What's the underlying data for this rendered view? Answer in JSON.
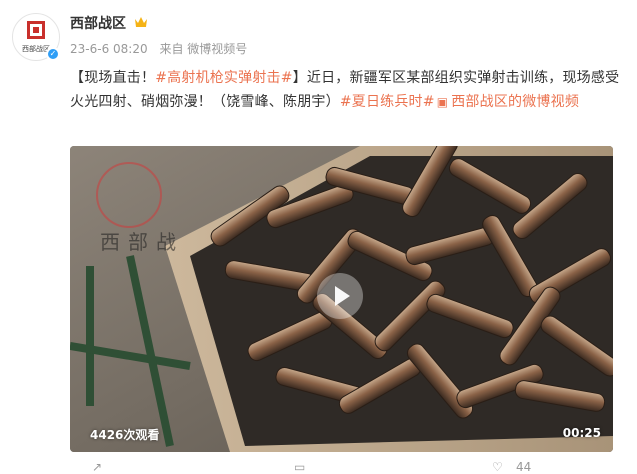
{
  "account": {
    "name": "西部战区",
    "avatar_label": "西部战区",
    "avatar_glyph": "西"
  },
  "meta": {
    "date": "23-6-6 08:20",
    "source": "来自 微博视频号"
  },
  "post": {
    "prefix": "【现场直击！",
    "tag1": "#高射机枪实弹射击#",
    "text1": "】近日，新疆军区某部组织实弹射击训练，现场感受火光四射、硝烟弥漫！（饶雪峰、陈朋宇）",
    "tag2": "#夏日练兵时#",
    "link": "西部战区的微博视频"
  },
  "video": {
    "views": "4426次观看",
    "duration": "00:25",
    "watermark_text": "西部战"
  },
  "actions": {
    "comment_count": "44"
  },
  "colors": {
    "accent": "#eb7350",
    "verified": "#2f9ef6",
    "crown": "#f5b316"
  }
}
